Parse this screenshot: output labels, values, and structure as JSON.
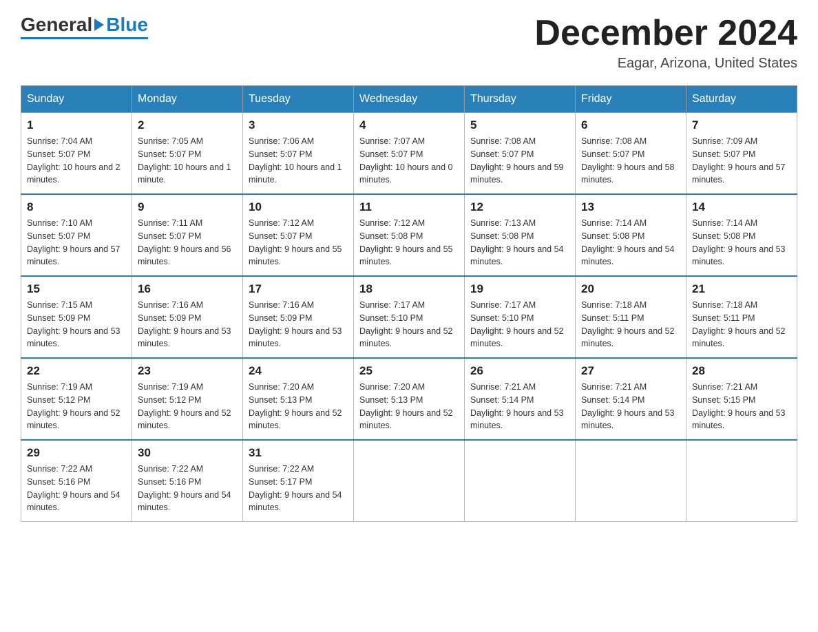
{
  "header": {
    "logo": {
      "text1": "General",
      "text2": "Blue"
    },
    "title": "December 2024",
    "location": "Eagar, Arizona, United States"
  },
  "days_of_week": [
    "Sunday",
    "Monday",
    "Tuesday",
    "Wednesday",
    "Thursday",
    "Friday",
    "Saturday"
  ],
  "weeks": [
    [
      {
        "day": "1",
        "sunrise": "7:04 AM",
        "sunset": "5:07 PM",
        "daylight": "10 hours and 2 minutes."
      },
      {
        "day": "2",
        "sunrise": "7:05 AM",
        "sunset": "5:07 PM",
        "daylight": "10 hours and 1 minute."
      },
      {
        "day": "3",
        "sunrise": "7:06 AM",
        "sunset": "5:07 PM",
        "daylight": "10 hours and 1 minute."
      },
      {
        "day": "4",
        "sunrise": "7:07 AM",
        "sunset": "5:07 PM",
        "daylight": "10 hours and 0 minutes."
      },
      {
        "day": "5",
        "sunrise": "7:08 AM",
        "sunset": "5:07 PM",
        "daylight": "9 hours and 59 minutes."
      },
      {
        "day": "6",
        "sunrise": "7:08 AM",
        "sunset": "5:07 PM",
        "daylight": "9 hours and 58 minutes."
      },
      {
        "day": "7",
        "sunrise": "7:09 AM",
        "sunset": "5:07 PM",
        "daylight": "9 hours and 57 minutes."
      }
    ],
    [
      {
        "day": "8",
        "sunrise": "7:10 AM",
        "sunset": "5:07 PM",
        "daylight": "9 hours and 57 minutes."
      },
      {
        "day": "9",
        "sunrise": "7:11 AM",
        "sunset": "5:07 PM",
        "daylight": "9 hours and 56 minutes."
      },
      {
        "day": "10",
        "sunrise": "7:12 AM",
        "sunset": "5:07 PM",
        "daylight": "9 hours and 55 minutes."
      },
      {
        "day": "11",
        "sunrise": "7:12 AM",
        "sunset": "5:08 PM",
        "daylight": "9 hours and 55 minutes."
      },
      {
        "day": "12",
        "sunrise": "7:13 AM",
        "sunset": "5:08 PM",
        "daylight": "9 hours and 54 minutes."
      },
      {
        "day": "13",
        "sunrise": "7:14 AM",
        "sunset": "5:08 PM",
        "daylight": "9 hours and 54 minutes."
      },
      {
        "day": "14",
        "sunrise": "7:14 AM",
        "sunset": "5:08 PM",
        "daylight": "9 hours and 53 minutes."
      }
    ],
    [
      {
        "day": "15",
        "sunrise": "7:15 AM",
        "sunset": "5:09 PM",
        "daylight": "9 hours and 53 minutes."
      },
      {
        "day": "16",
        "sunrise": "7:16 AM",
        "sunset": "5:09 PM",
        "daylight": "9 hours and 53 minutes."
      },
      {
        "day": "17",
        "sunrise": "7:16 AM",
        "sunset": "5:09 PM",
        "daylight": "9 hours and 53 minutes."
      },
      {
        "day": "18",
        "sunrise": "7:17 AM",
        "sunset": "5:10 PM",
        "daylight": "9 hours and 52 minutes."
      },
      {
        "day": "19",
        "sunrise": "7:17 AM",
        "sunset": "5:10 PM",
        "daylight": "9 hours and 52 minutes."
      },
      {
        "day": "20",
        "sunrise": "7:18 AM",
        "sunset": "5:11 PM",
        "daylight": "9 hours and 52 minutes."
      },
      {
        "day": "21",
        "sunrise": "7:18 AM",
        "sunset": "5:11 PM",
        "daylight": "9 hours and 52 minutes."
      }
    ],
    [
      {
        "day": "22",
        "sunrise": "7:19 AM",
        "sunset": "5:12 PM",
        "daylight": "9 hours and 52 minutes."
      },
      {
        "day": "23",
        "sunrise": "7:19 AM",
        "sunset": "5:12 PM",
        "daylight": "9 hours and 52 minutes."
      },
      {
        "day": "24",
        "sunrise": "7:20 AM",
        "sunset": "5:13 PM",
        "daylight": "9 hours and 52 minutes."
      },
      {
        "day": "25",
        "sunrise": "7:20 AM",
        "sunset": "5:13 PM",
        "daylight": "9 hours and 52 minutes."
      },
      {
        "day": "26",
        "sunrise": "7:21 AM",
        "sunset": "5:14 PM",
        "daylight": "9 hours and 53 minutes."
      },
      {
        "day": "27",
        "sunrise": "7:21 AM",
        "sunset": "5:14 PM",
        "daylight": "9 hours and 53 minutes."
      },
      {
        "day": "28",
        "sunrise": "7:21 AM",
        "sunset": "5:15 PM",
        "daylight": "9 hours and 53 minutes."
      }
    ],
    [
      {
        "day": "29",
        "sunrise": "7:22 AM",
        "sunset": "5:16 PM",
        "daylight": "9 hours and 54 minutes."
      },
      {
        "day": "30",
        "sunrise": "7:22 AM",
        "sunset": "5:16 PM",
        "daylight": "9 hours and 54 minutes."
      },
      {
        "day": "31",
        "sunrise": "7:22 AM",
        "sunset": "5:17 PM",
        "daylight": "9 hours and 54 minutes."
      },
      null,
      null,
      null,
      null
    ]
  ],
  "labels": {
    "sunrise": "Sunrise:",
    "sunset": "Sunset:",
    "daylight": "Daylight:"
  }
}
